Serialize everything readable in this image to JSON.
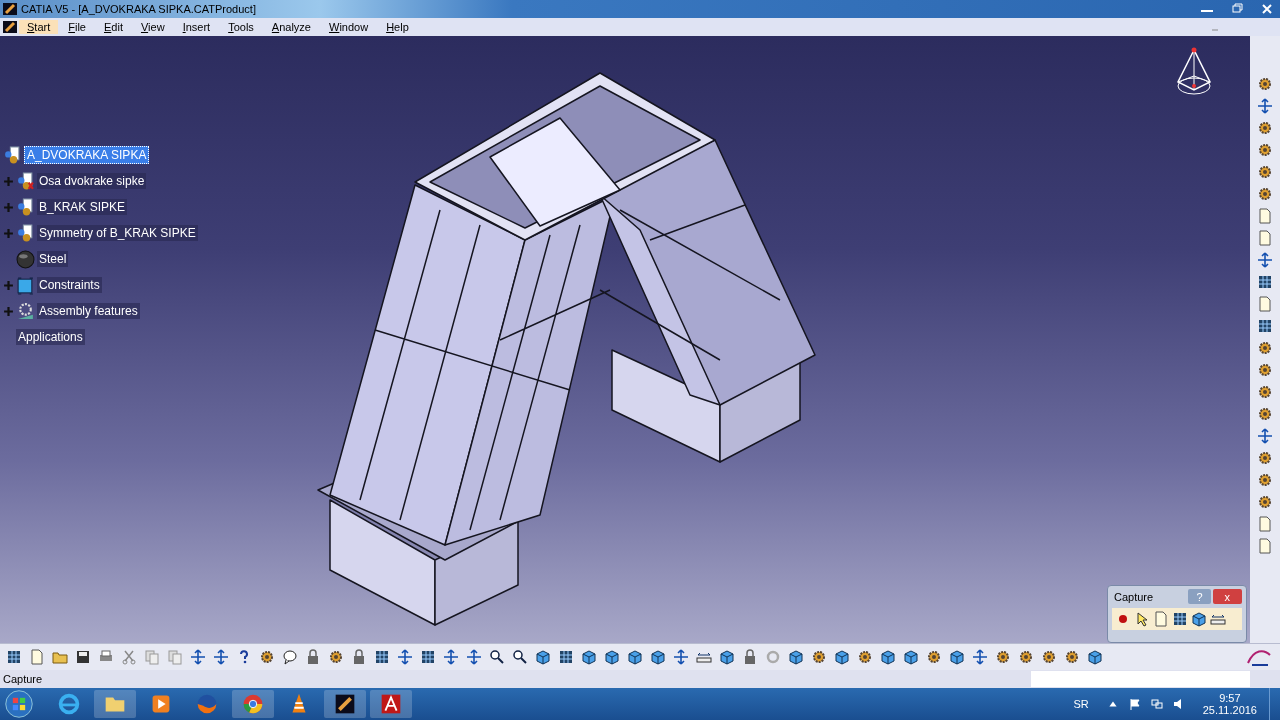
{
  "window": {
    "title": "CATIA V5 - [A_DVOKRAKA SIPKA.CATProduct]"
  },
  "menu": [
    {
      "label": "Start",
      "selected": true
    },
    {
      "label": "File",
      "selected": false
    },
    {
      "label": "Edit",
      "selected": false
    },
    {
      "label": "View",
      "selected": false
    },
    {
      "label": "Insert",
      "selected": false
    },
    {
      "label": "Tools",
      "selected": false
    },
    {
      "label": "Analyze",
      "selected": false
    },
    {
      "label": "Window",
      "selected": false
    },
    {
      "label": "Help",
      "selected": false
    }
  ],
  "tree": {
    "label": "A_DVOKRAKA SIPKA",
    "selected": true,
    "children": [
      {
        "label": "Osa dvokrake sipke",
        "kind": "part",
        "expandable": true,
        "selected": false
      },
      {
        "label": "B_KRAK SIPKE",
        "kind": "product",
        "expandable": true,
        "selected": false
      },
      {
        "label": "Symmetry of B_KRAK SIPKE",
        "kind": "product",
        "expandable": true,
        "selected": false
      },
      {
        "label": "Steel",
        "kind": "material",
        "expandable": false,
        "selected": false
      },
      {
        "label": "Constraints",
        "kind": "constraints",
        "expandable": true,
        "selected": false
      },
      {
        "label": "Assembly features",
        "kind": "features",
        "expandable": true,
        "selected": false
      },
      {
        "label": "Applications",
        "kind": "plain",
        "expandable": false,
        "selected": false
      }
    ]
  },
  "capture_dialog": {
    "title": "Capture",
    "help": "?",
    "close": "x"
  },
  "status_bar": {
    "text": "Capture"
  },
  "taskbar": {
    "language": "SR",
    "time": "9:57",
    "date": "25.11.2016"
  }
}
